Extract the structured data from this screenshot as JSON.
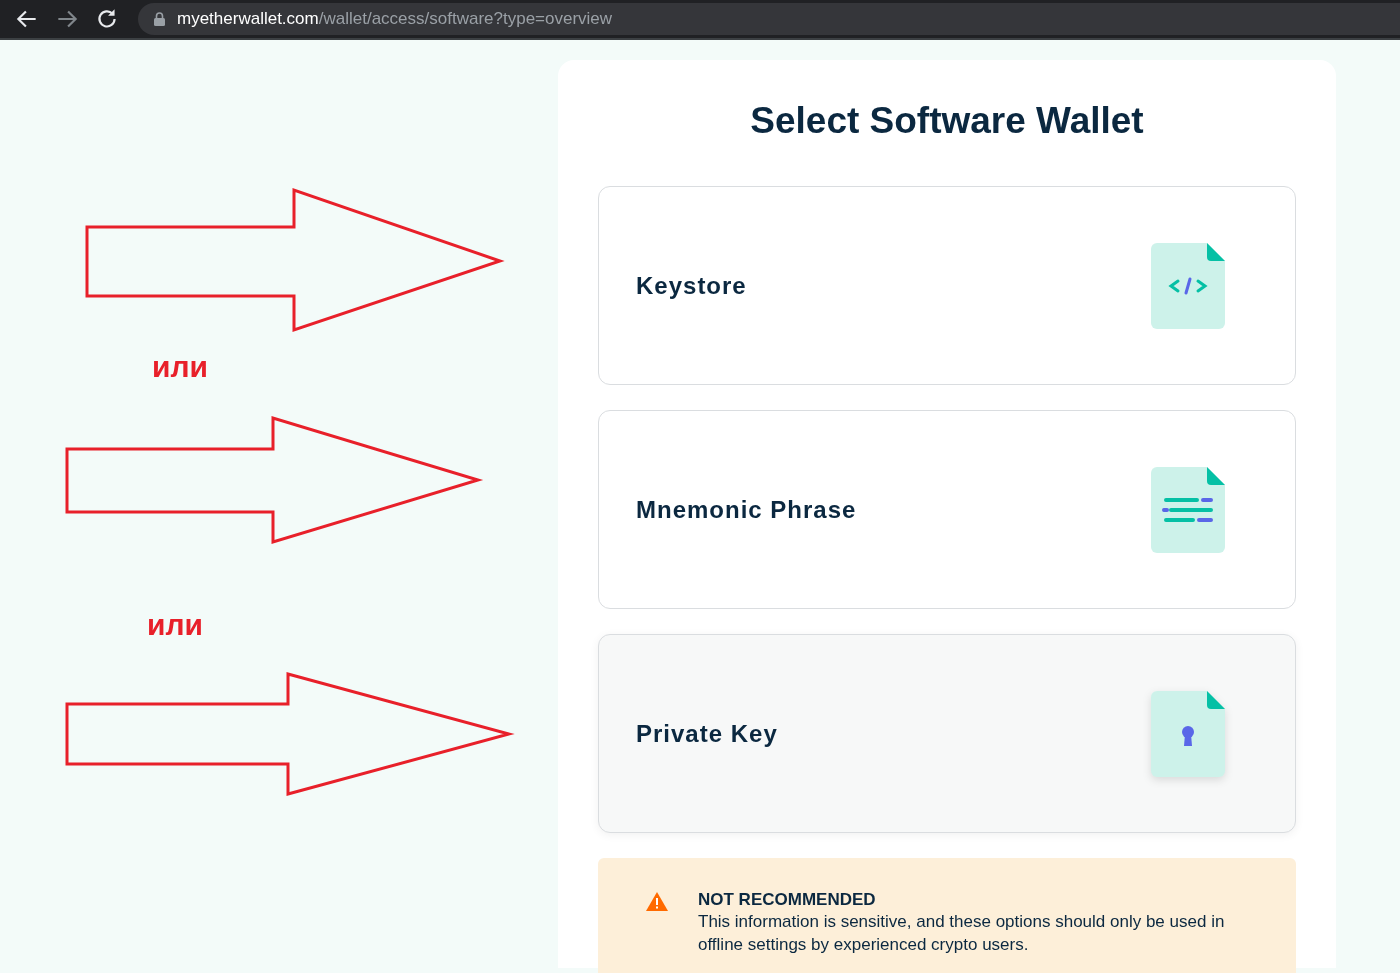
{
  "browser": {
    "url_host": "myetherwallet.com",
    "url_path": "/wallet/access/software?type=overview"
  },
  "annotations": [
    {
      "kind": "arrow"
    },
    {
      "kind": "label",
      "text": "или"
    },
    {
      "kind": "arrow"
    },
    {
      "kind": "label",
      "text": "или"
    },
    {
      "kind": "arrow"
    }
  ],
  "title": "Select Software Wallet",
  "options": [
    {
      "label": "Keystore",
      "kind": "code",
      "hovered": false
    },
    {
      "label": "Mnemonic Phrase",
      "kind": "lines",
      "hovered": false
    },
    {
      "label": "Private Key",
      "kind": "key",
      "hovered": true
    }
  ],
  "warning": {
    "title": "NOT RECOMMENDED",
    "text": "This information is sensitive, and these options should only be used in offline settings by experienced crypto users."
  }
}
